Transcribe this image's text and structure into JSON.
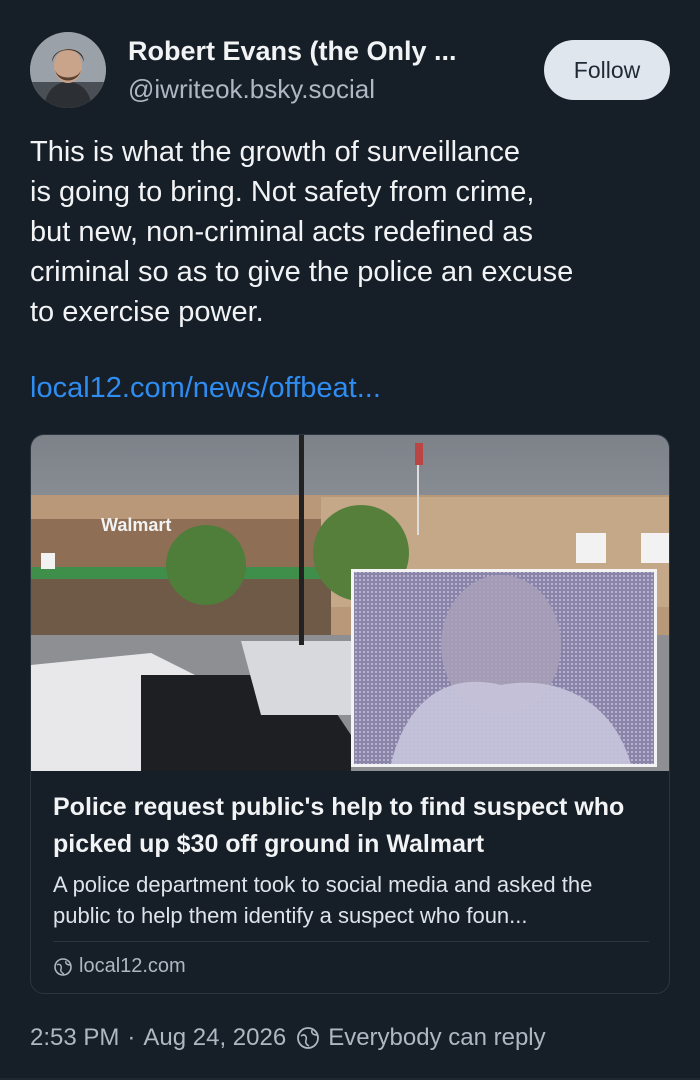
{
  "author": {
    "name": "Robert Evans (the Only ...",
    "handle": "@iwriteok.bsky.social",
    "avatar_icon": "avatar-portrait"
  },
  "follow_label": "Follow",
  "post": {
    "text": "This is what the growth of surveillance\nis going to bring. Not safety from crime,\nbut new, non-criminal acts redefined as\ncriminal so as to give the police an excuse\nto exercise power.",
    "link_text": "local12.com/news/offbeat..."
  },
  "card": {
    "image_icon": "walmart-store-photo",
    "store_sign": "Walmart",
    "title": "Police request public's help to find suspect who picked up $30 off ground in Walmart",
    "description": "A police department took to social media and asked the public to help them identify a suspect who foun...",
    "domain": "local12.com"
  },
  "meta": {
    "time": "2:53 PM",
    "separator": "·",
    "date": "Aug 24, 2026",
    "reply_setting": "Everybody can reply"
  },
  "colors": {
    "background": "#161e27",
    "link": "#2f8cf0",
    "follow_bg": "#dfe6ee",
    "muted": "#aeb7c2"
  }
}
